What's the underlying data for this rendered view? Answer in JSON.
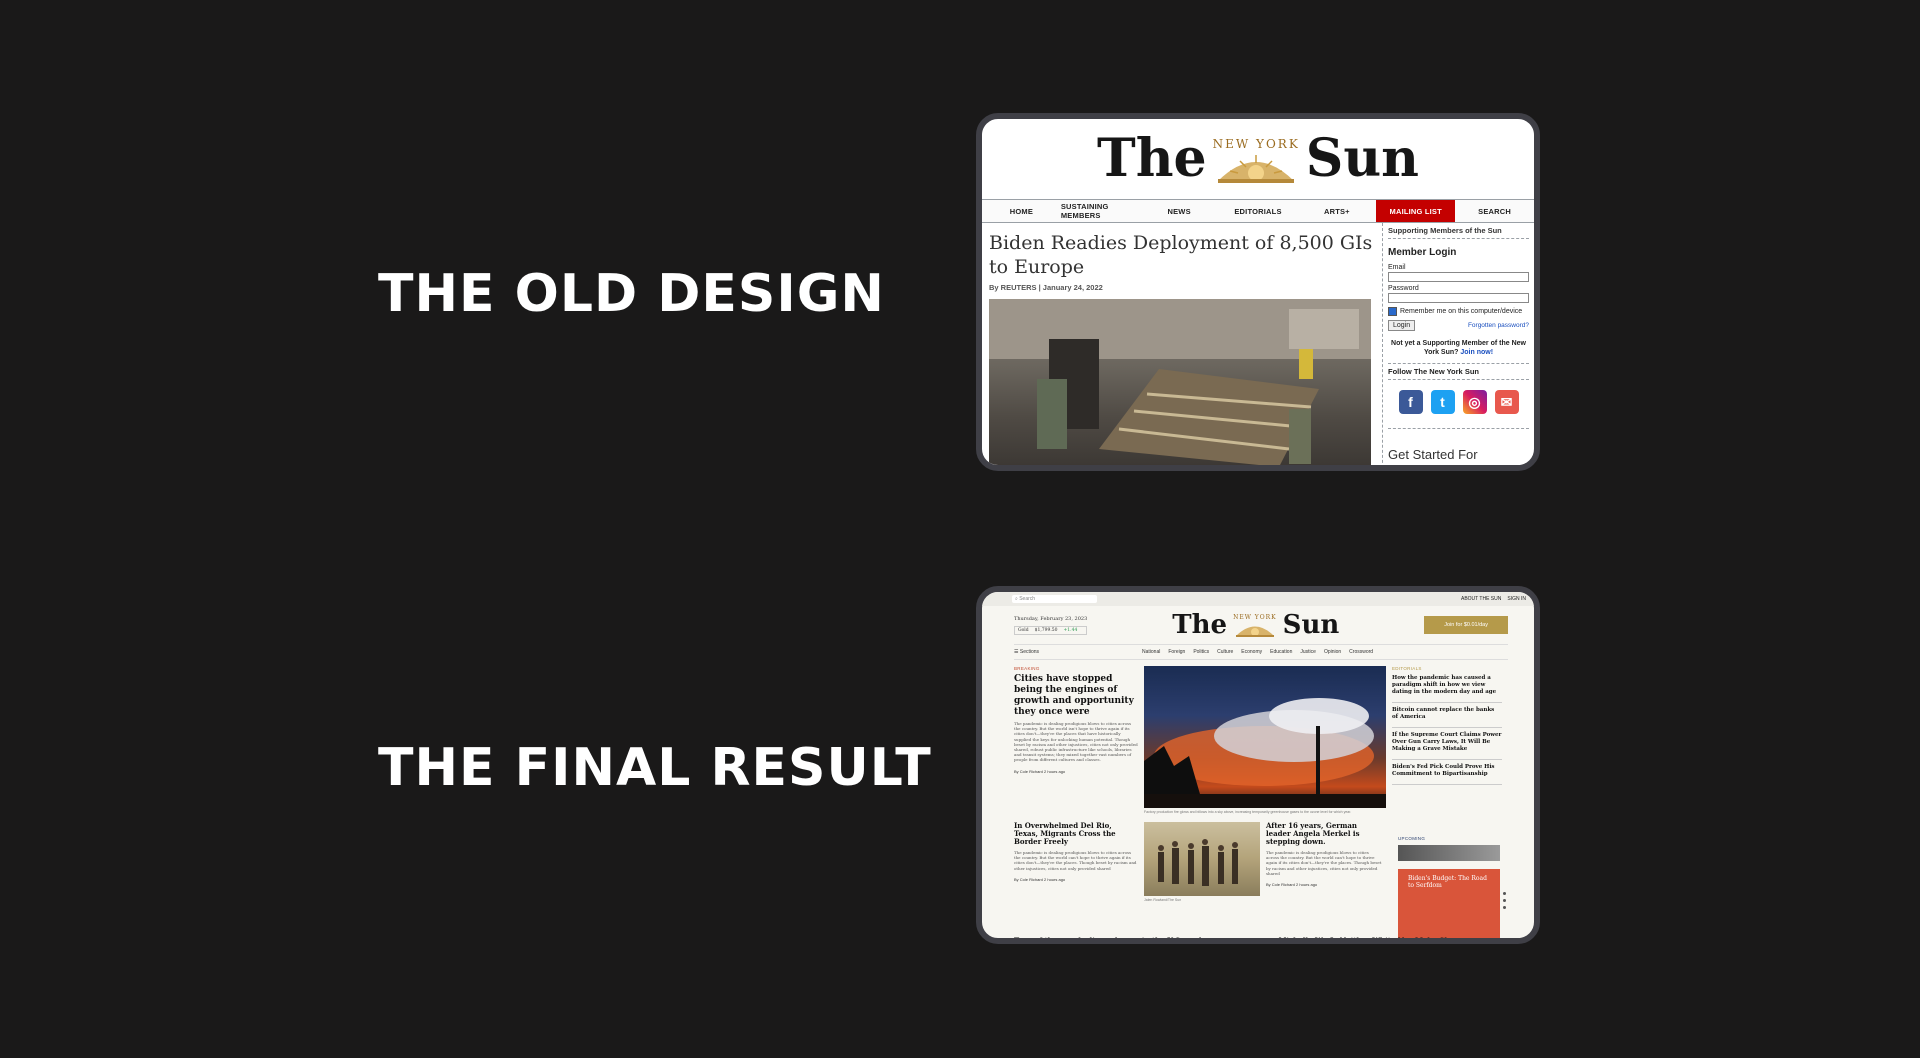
{
  "headings": {
    "old": "THE OLD DESIGN",
    "new": "THE FINAL RESULT"
  },
  "brand": {
    "the": "The",
    "seal": "NEW YORK",
    "sun": "Sun"
  },
  "old": {
    "nav": [
      "HOME",
      "SUSTAINING MEMBERS",
      "NEWS",
      "EDITORIALS",
      "ARTS+",
      "MAILING LIST",
      "SEARCH"
    ],
    "headline": "Biden Readies Deployment of 8,500 GIs to Europe",
    "byline": "By REUTERS | January 24, 2022",
    "sidebar": {
      "title": "Supporting Members of the Sun",
      "login_title": "Member Login",
      "email_label": "Email",
      "password_label": "Password",
      "remember": "Remember me on this computer/device",
      "login_button": "Login",
      "forgot": "Forgotten password?",
      "not_member": "Not yet a Supporting Member of the New York Sun?",
      "join": "Join now!",
      "follow": "Follow The New York Sun",
      "ad": "Get Started For"
    }
  },
  "new": {
    "top": {
      "search_placeholder": "Search",
      "about": "ABOUT THE SUN",
      "signin": "SIGN IN"
    },
    "date": "Thursday, February 23, 2023",
    "gold": {
      "label": "Gold",
      "price": "$1,799.50",
      "change": "+1.44"
    },
    "join_button": "Join for $0.01/day",
    "sections": "Sections",
    "cats": [
      "National",
      "Foreign",
      "Politics",
      "Culture",
      "Economy",
      "Education",
      "Justice",
      "Opinion",
      "Crossword"
    ],
    "breaking_tag": "BREAKING",
    "lead_headline": "Cities have stopped being the engines of growth and opportunity they once were",
    "lead_body": "The pandemic is dealing prodigious blows to cities across the country. But the world isn't hope to thrive again if its cities don't—they're the places that have historically supplied the keys for unlocking human potential. Though beset by racism and other injustices, cities not only provided shared, robust public infrastructure like schools, libraries and transit systems; they mixed together vast numbers of people from different cultures and classes.",
    "lead_meta": "By Cole Richard   2 hours ago",
    "hero_caption": "Factory production fire glows and billows into a sky above, increasing temporarily greenhouse gases to the ozone level for which year.",
    "editorials_tag": "EDITORIALS",
    "editorials": [
      "How the pandemic has caused a paradigm shift in how we view dating in the modern day and age",
      "Bitcoin cannot replace the banks of America",
      "If the Supreme Court Claims Power Over Gun Carry Laws, It Will Be Making a Grave Mistake",
      "Biden's Fed Pick Could Prove His Commitment to Bipartisanship"
    ],
    "story2_headline": "In Overwhelmed Del Rio, Texas, Migrants Cross the Border Freely",
    "story2_body": "The pandemic is dealing prodigious blows to cities across the country. But the world can't hope to thrive again if its cities don't—they're the places. Though beset by racism and other injustices, cities not only provided shared",
    "story2_meta": "By Cole Richard   2 hours ago",
    "photo2_caption": "Jalen Rowland/The Sun",
    "story3_headline": "After 16 years, German leader Angela Merkel is stepping down.",
    "story3_body": "The pandemic is dealing prodigious blows to cities across the country. But the world can't hope to thrive again if its cities don't—they're the places. Though beset by racism and other injustices, cities not only provided shared",
    "story3_meta": "By Cole Richard   2 hours ago",
    "upcoming_tag": "UPCOMING",
    "upcoming_title": "Biden's Budget: The Road to Serfdom",
    "bottom_left": "Tens of thousands die each year in the U.S., and",
    "bottom_right": "Michelle Wu Is Neither White Nor Male. She"
  },
  "colors": {
    "background": "#1a1919",
    "mailing_red": "#c40000",
    "gold": "#b59a4a",
    "upcoming_red": "#d9553a"
  },
  "icons": [
    "facebook-icon",
    "twitter-icon",
    "instagram-icon",
    "mail-icon",
    "hamburger-icon",
    "search-icon"
  ]
}
